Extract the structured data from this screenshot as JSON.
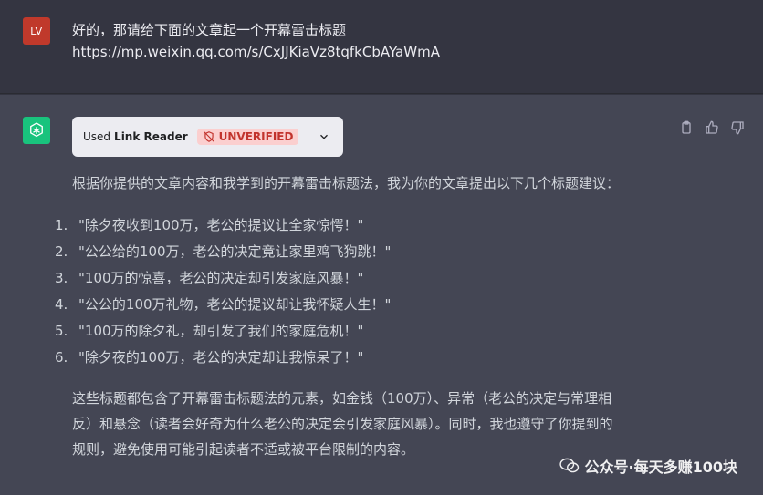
{
  "user_message": {
    "avatar_initials": "LV",
    "line1": "好的，那请给下面的文章起一个开幕雷击标题",
    "line2": "https://mp.weixin.qq.com/s/CxJJKiaVz8tqfkCbAYaWmA"
  },
  "assistant_message": {
    "plugin": {
      "used_label": "Used",
      "name": "Link Reader",
      "status": "UNVERIFIED"
    },
    "intro": "根据你提供的文章内容和我学到的开幕雷击标题法，我为你的文章提出以下几个标题建议：",
    "titles": [
      {
        "num": "1.",
        "text": "\"除夕夜收到100万，老公的提议让全家惊愕！\""
      },
      {
        "num": "2.",
        "text": "\"公公给的100万，老公的决定竟让家里鸡飞狗跳！\""
      },
      {
        "num": "3.",
        "text": "\"100万的惊喜，老公的决定却引发家庭风暴！\""
      },
      {
        "num": "4.",
        "text": "\"公公的100万礼物，老公的提议却让我怀疑人生！\""
      },
      {
        "num": "5.",
        "text": "\"100万的除夕礼，却引发了我们的家庭危机！\""
      },
      {
        "num": "6.",
        "text": "\"除夕夜的100万，老公的决定却让我惊呆了！\""
      }
    ],
    "outro_line1": "这些标题都包含了开幕雷击标题法的元素，如金钱（100万）、异常（老公的决定与常理相",
    "outro_line2": "反）和悬念（读者会好奇为什么老公的决定会引发家庭风暴）。同时，我也遵守了你提到的",
    "outro_line3": "规则，避免使用可能引起读者不适或被平台限制的内容。"
  },
  "watermark": "公众号·每天多赚100块",
  "icons": [
    "clipboard-icon",
    "thumbs-up-icon",
    "thumbs-down-icon",
    "chevron-down-icon",
    "openai-logo-icon",
    "shield-off-icon"
  ],
  "colors": {
    "background": "#343541",
    "assistant_bg": "#444654",
    "user_avatar": "#c0392b",
    "bot_avatar": "#19c37d",
    "badge_bg": "#fbcfcf",
    "badge_text": "#c2332d"
  }
}
